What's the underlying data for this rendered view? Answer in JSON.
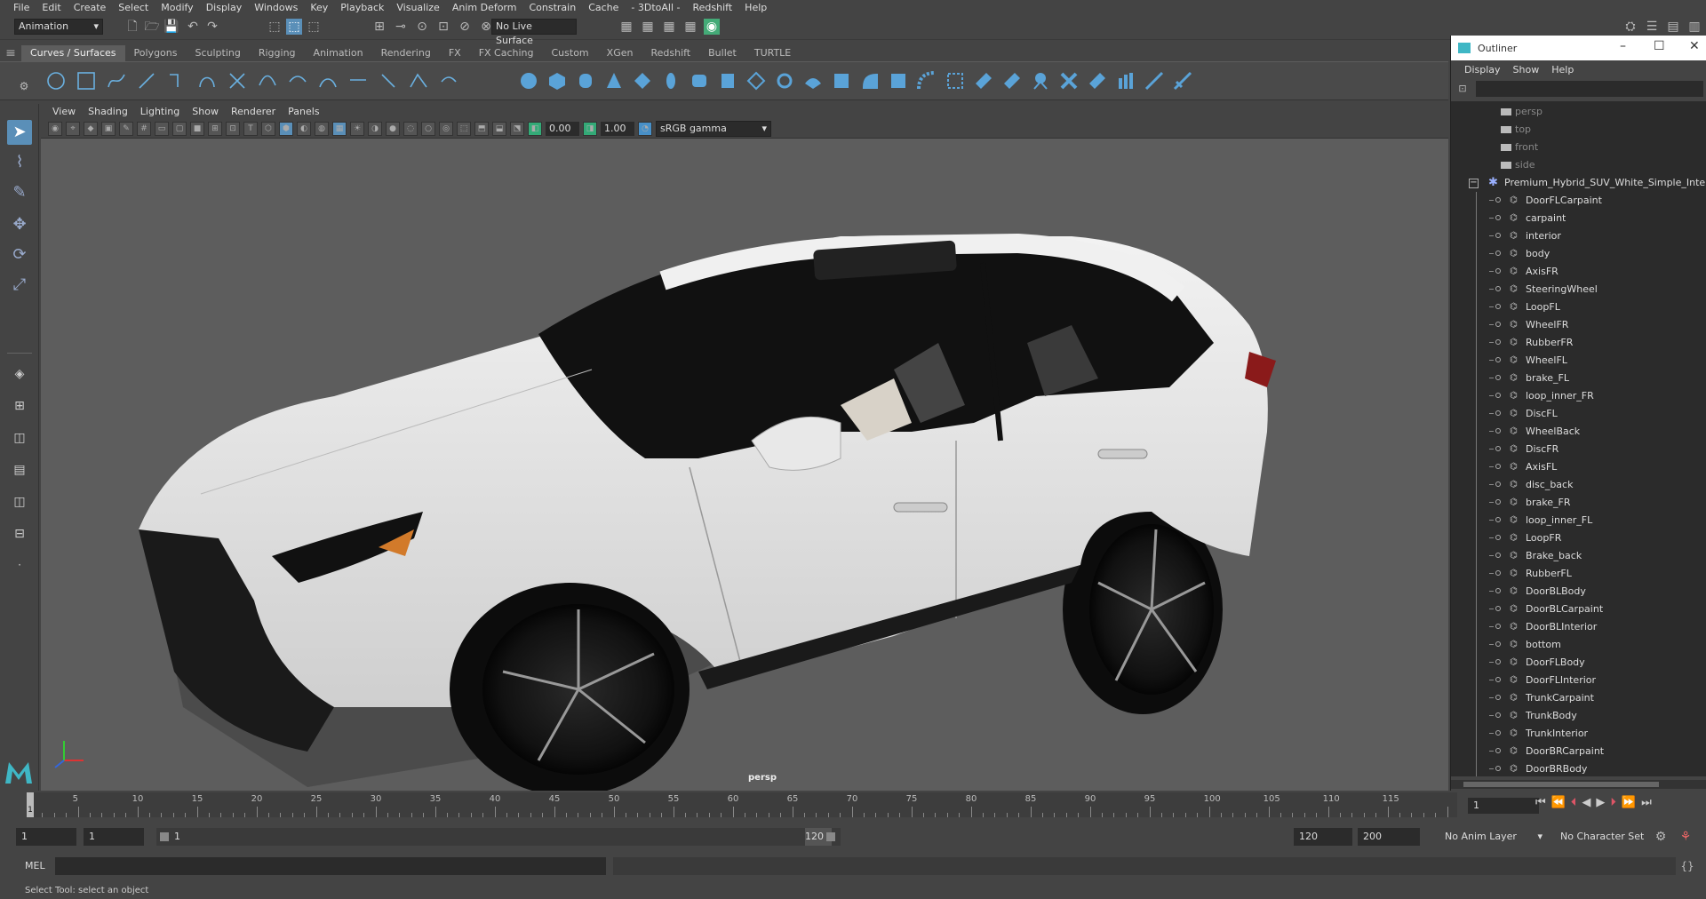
{
  "menubar": [
    "File",
    "Edit",
    "Create",
    "Select",
    "Modify",
    "Display",
    "Windows",
    "Key",
    "Playback",
    "Visualize",
    "Anim Deform",
    "Constrain",
    "Cache",
    "- 3DtoAll -",
    "Redshift",
    "Help"
  ],
  "toolbar": {
    "mode": "Animation",
    "live_surface": "No Live Surface"
  },
  "shelf_tabs": [
    "Curves / Surfaces",
    "Polygons",
    "Sculpting",
    "Rigging",
    "Animation",
    "Rendering",
    "FX",
    "FX Caching",
    "Custom",
    "XGen",
    "Redshift",
    "Bullet",
    "TURTLE"
  ],
  "viewport": {
    "menu": [
      "View",
      "Shading",
      "Lighting",
      "Show",
      "Renderer",
      "Panels"
    ],
    "exposure": "0.00",
    "gamma": "1.00",
    "color_space": "sRGB gamma",
    "camera": "persp"
  },
  "outliner": {
    "title": "Outliner",
    "menu": [
      "Display",
      "Show",
      "Help"
    ],
    "cameras": [
      "persp",
      "top",
      "front",
      "side"
    ],
    "root": "Premium_Hybrid_SUV_White_Simple_Interior",
    "items": [
      "DoorFLCarpaint",
      "carpaint",
      "interior",
      "body",
      "AxisFR",
      "SteeringWheel",
      "LoopFL",
      "WheelFR",
      "RubberFR",
      "WheelFL",
      "brake_FL",
      "loop_inner_FR",
      "DiscFL",
      "WheelBack",
      "DiscFR",
      "AxisFL",
      "disc_back",
      "brake_FR",
      "loop_inner_FL",
      "LoopFR",
      "Brake_back",
      "RubberFL",
      "DoorBLBody",
      "DoorBLCarpaint",
      "DoorBLInterior",
      "bottom",
      "DoorFLBody",
      "DoorFLInterior",
      "TrunkCarpaint",
      "TrunkBody",
      "TrunkInterior",
      "DoorBRCarpaint",
      "DoorBRBody"
    ]
  },
  "timeline": {
    "ticks": [
      "5",
      "10",
      "15",
      "20",
      "25",
      "30",
      "35",
      "40",
      "45",
      "50",
      "55",
      "60",
      "65",
      "70",
      "75",
      "80",
      "85",
      "90",
      "95",
      "100",
      "105",
      "110",
      "115"
    ],
    "current_frame_label": "1",
    "current_frame_field": "1"
  },
  "range": {
    "start": "1",
    "start2": "1",
    "slider_start": "1",
    "slider_end": "120",
    "end": "120",
    "end2": "200",
    "anim_layer": "No Anim Layer",
    "character_set": "No Character Set"
  },
  "command": {
    "lang": "MEL"
  },
  "status": "Select Tool: select an object"
}
